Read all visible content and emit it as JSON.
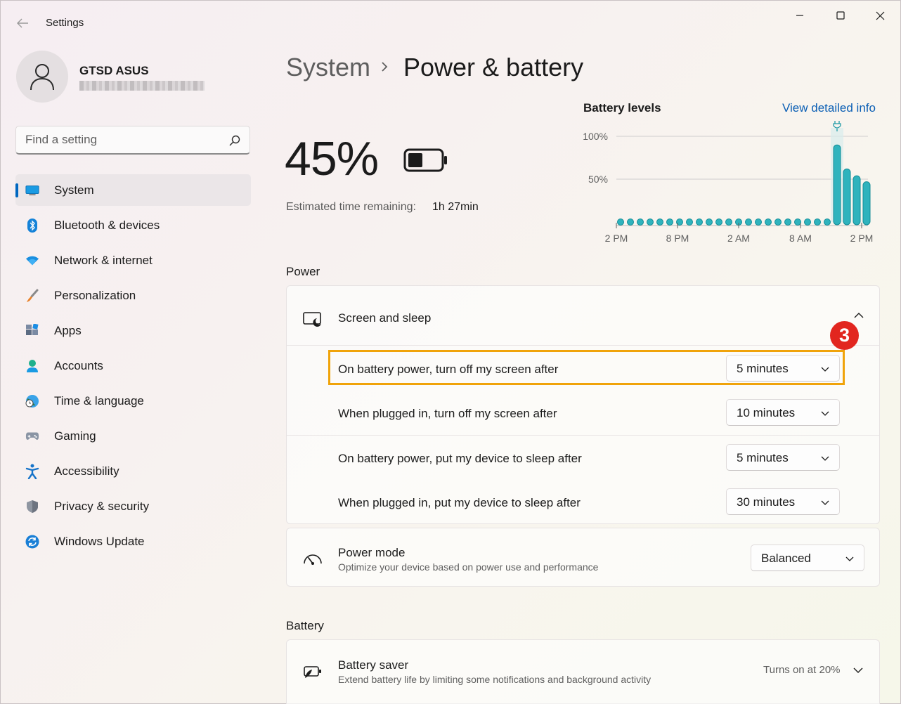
{
  "window": {
    "title": "Settings"
  },
  "profile": {
    "name": "GTSD ASUS"
  },
  "search": {
    "placeholder": "Find a setting"
  },
  "sidebar": {
    "items": [
      {
        "label": "System",
        "icon": "system-icon",
        "active": true
      },
      {
        "label": "Bluetooth & devices",
        "icon": "bluetooth-icon"
      },
      {
        "label": "Network & internet",
        "icon": "wifi-icon"
      },
      {
        "label": "Personalization",
        "icon": "brush-icon"
      },
      {
        "label": "Apps",
        "icon": "apps-icon"
      },
      {
        "label": "Accounts",
        "icon": "accounts-icon"
      },
      {
        "label": "Time & language",
        "icon": "globe-clock-icon"
      },
      {
        "label": "Gaming",
        "icon": "gamepad-icon"
      },
      {
        "label": "Accessibility",
        "icon": "accessibility-icon"
      },
      {
        "label": "Privacy & security",
        "icon": "shield-icon"
      },
      {
        "label": "Windows Update",
        "icon": "update-icon"
      }
    ]
  },
  "header": {
    "parent": "System",
    "current": "Power & battery"
  },
  "battery": {
    "percent": "45%",
    "percent_value": 45,
    "estimate_label": "Estimated time remaining:",
    "estimate_value": "1h 27min"
  },
  "chart_data": {
    "type": "bar",
    "title": "Battery levels",
    "link": "View detailed info",
    "y_ticks": [
      "100%",
      "50%"
    ],
    "x_ticks": [
      "2 PM",
      "8 PM",
      "2 AM",
      "8 AM",
      "2 PM"
    ],
    "ylim": [
      0,
      100
    ],
    "values": [
      0,
      0,
      0,
      0,
      0,
      0,
      0,
      0,
      0,
      0,
      0,
      0,
      0,
      0,
      0,
      0,
      0,
      0,
      0,
      0,
      0,
      0,
      90,
      62,
      54,
      47
    ],
    "plugged_in_index": 20
  },
  "power": {
    "section_title": "Power",
    "screen_sleep": {
      "title": "Screen and sleep",
      "rows": [
        {
          "label": "On battery power, turn off my screen after",
          "value": "5 minutes"
        },
        {
          "label": "When plugged in, turn off my screen after",
          "value": "10 minutes"
        },
        {
          "label": "On battery power, put my device to sleep after",
          "value": "5 minutes"
        },
        {
          "label": "When plugged in, put my device to sleep after",
          "value": "30 minutes"
        }
      ]
    },
    "power_mode": {
      "title": "Power mode",
      "description": "Optimize your device based on power use and performance",
      "value": "Balanced"
    }
  },
  "battery_section": {
    "title": "Battery",
    "saver": {
      "title": "Battery saver",
      "description": "Extend battery life by limiting some notifications and background activity",
      "status": "Turns on at 20%"
    }
  },
  "annotation": {
    "step": "3",
    "color": "#f0a30a",
    "badge_color": "#e2261f"
  }
}
